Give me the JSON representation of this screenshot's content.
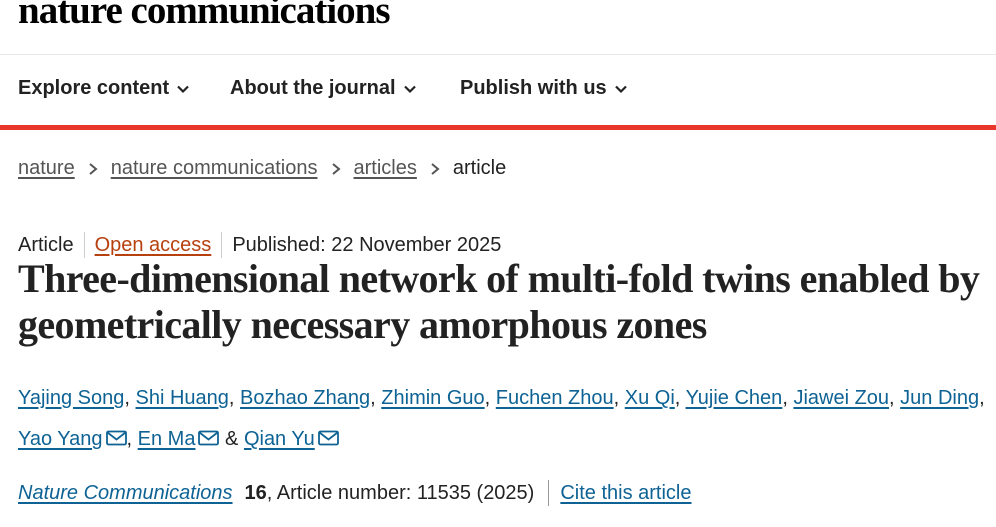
{
  "site": {
    "logo": "nature communications"
  },
  "nav": {
    "items": [
      {
        "label": "Explore content"
      },
      {
        "label": "About the journal"
      },
      {
        "label": "Publish with us"
      }
    ]
  },
  "breadcrumb": {
    "items": [
      "nature",
      "nature communications",
      "articles"
    ],
    "current": "article"
  },
  "article": {
    "type": "Article",
    "access": "Open access",
    "published": "Published: 22 November 2025",
    "title": "Three-dimensional network of multi-fold twins enabled by geometrically necessary amorphous zones",
    "authors": [
      "Yajing Song",
      "Shi Huang",
      "Bozhao Zhang",
      "Zhimin Guo",
      "Fuchen Zhou",
      "Xu Qi",
      "Yujie Chen",
      "Jiawei Zou",
      "Jun Ding",
      "Yao Yang",
      "En Ma",
      "Qian Yu"
    ],
    "author_separator": ",",
    "author_conjunction": "&",
    "citation": {
      "journal": "Nature Communications",
      "volume": "16",
      "rest": ", Article number: 11535 (2025)",
      "cite_link": "Cite this article"
    }
  },
  "colors": {
    "accent": "#e8362c",
    "link": "#0e6394",
    "open_access": "#b7400f"
  },
  "icons": [
    "chevron-down-icon",
    "chevron-right-icon",
    "mail-icon"
  ]
}
